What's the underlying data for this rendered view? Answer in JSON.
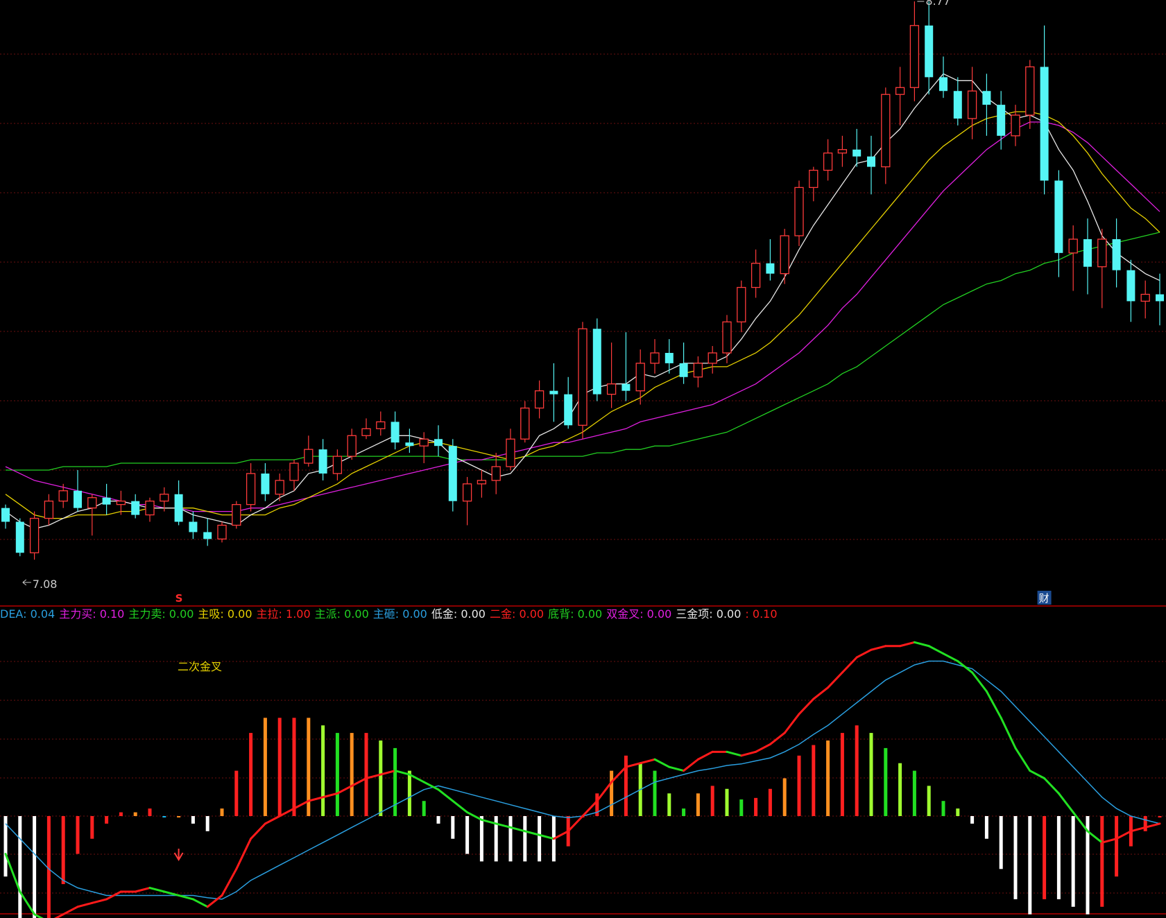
{
  "colors": {
    "background": "#000000",
    "grid": "#6e1010",
    "divider": "#b80000",
    "up": "#ff3b3b",
    "down": "#55f5f5",
    "ma5": "#e8e8e8",
    "ma10": "#e6d000",
    "ma20": "#e020e0",
    "ma60": "#22d022",
    "dif_rise": "#ff1a1a",
    "dif_fall": "#22e022",
    "dea": "#2a9fe0",
    "hist_neg": "#ffffff",
    "hist_neg_red": "#ff2020",
    "hist_pos_red": "#ff2020",
    "hist_pos_orange": "#ff9020",
    "hist_pos_green": "#22e022",
    "hist_pos_yellowgreen": "#a0ff30",
    "hist_blue": "#17b8f0"
  },
  "price_panel": {
    "high_label": "8.77",
    "low_label": "7.08",
    "s_marker": "S",
    "cai_marker": "财"
  },
  "legend": {
    "items": [
      {
        "name": "DEA",
        "value": "0.04",
        "color": "#2a9fe0"
      },
      {
        "name": "主力买",
        "value": "0.10",
        "color": "#e020e0"
      },
      {
        "name": "主力卖",
        "value": "0.00",
        "color": "#22d022"
      },
      {
        "name": "主吸",
        "value": "0.00",
        "color": "#e6d000"
      },
      {
        "name": "主拉",
        "value": "1.00",
        "color": "#ff2020"
      },
      {
        "name": "主派",
        "value": "0.00",
        "color": "#22d022"
      },
      {
        "name": "主砸",
        "value": "0.00",
        "color": "#2a9fe0"
      },
      {
        "name": "低金",
        "value": "0.00",
        "color": "#e8e8e8"
      },
      {
        "name": "二金",
        "value": "0.00",
        "color": "#ff2020"
      },
      {
        "name": "底背",
        "value": "0.00",
        "color": "#22d022"
      },
      {
        "name": "双金叉",
        "value": "0.00",
        "color": "#e020e0"
      },
      {
        "name": "三金项",
        "value": "0.00",
        "color": "#e8e8e8"
      },
      {
        "name": "",
        "value": "0.10",
        "color": "#ff2020"
      }
    ]
  },
  "macd_panel": {
    "annotation": "二次金叉"
  },
  "chart_data": [
    {
      "type": "candlestick",
      "low_label": "7.08",
      "high_label": "8.77",
      "ylim": [
        7.08,
        8.77
      ],
      "ohlc": [
        [
          7.3,
          7.31,
          7.24,
          7.26
        ],
        [
          7.26,
          7.27,
          7.16,
          7.17
        ],
        [
          7.17,
          7.29,
          7.15,
          7.27
        ],
        [
          7.27,
          7.34,
          7.25,
          7.32
        ],
        [
          7.32,
          7.37,
          7.3,
          7.35
        ],
        [
          7.35,
          7.41,
          7.29,
          7.3
        ],
        [
          7.3,
          7.34,
          7.22,
          7.33
        ],
        [
          7.33,
          7.37,
          7.28,
          7.31
        ],
        [
          7.31,
          7.35,
          7.28,
          7.32
        ],
        [
          7.32,
          7.34,
          7.27,
          7.28
        ],
        [
          7.28,
          7.33,
          7.26,
          7.32
        ],
        [
          7.32,
          7.36,
          7.29,
          7.34
        ],
        [
          7.34,
          7.38,
          7.25,
          7.26
        ],
        [
          7.26,
          7.29,
          7.21,
          7.23
        ],
        [
          7.23,
          7.27,
          7.19,
          7.21
        ],
        [
          7.21,
          7.26,
          7.2,
          7.25
        ],
        [
          7.25,
          7.32,
          7.24,
          7.31
        ],
        [
          7.31,
          7.43,
          7.29,
          7.4
        ],
        [
          7.4,
          7.43,
          7.32,
          7.34
        ],
        [
          7.34,
          7.4,
          7.32,
          7.38
        ],
        [
          7.38,
          7.44,
          7.35,
          7.43
        ],
        [
          7.43,
          7.51,
          7.42,
          7.47
        ],
        [
          7.47,
          7.5,
          7.38,
          7.4
        ],
        [
          7.4,
          7.47,
          7.38,
          7.45
        ],
        [
          7.45,
          7.53,
          7.44,
          7.51
        ],
        [
          7.51,
          7.56,
          7.5,
          7.53
        ],
        [
          7.53,
          7.58,
          7.51,
          7.55
        ],
        [
          7.55,
          7.58,
          7.47,
          7.49
        ],
        [
          7.49,
          7.53,
          7.46,
          7.48
        ],
        [
          7.48,
          7.52,
          7.43,
          7.5
        ],
        [
          7.5,
          7.54,
          7.45,
          7.48
        ],
        [
          7.48,
          7.5,
          7.29,
          7.32
        ],
        [
          7.32,
          7.39,
          7.25,
          7.37
        ],
        [
          7.37,
          7.41,
          7.33,
          7.38
        ],
        [
          7.38,
          7.46,
          7.34,
          7.42
        ],
        [
          7.42,
          7.53,
          7.41,
          7.5
        ],
        [
          7.5,
          7.61,
          7.49,
          7.59
        ],
        [
          7.59,
          7.67,
          7.56,
          7.64
        ],
        [
          7.64,
          7.72,
          7.55,
          7.63
        ],
        [
          7.63,
          7.68,
          7.53,
          7.54
        ],
        [
          7.54,
          7.84,
          7.5,
          7.82
        ],
        [
          7.82,
          7.85,
          7.61,
          7.63
        ],
        [
          7.63,
          7.78,
          7.59,
          7.66
        ],
        [
          7.66,
          7.81,
          7.61,
          7.64
        ],
        [
          7.64,
          7.76,
          7.6,
          7.72
        ],
        [
          7.72,
          7.79,
          7.69,
          7.75
        ],
        [
          7.75,
          7.79,
          7.69,
          7.72
        ],
        [
          7.72,
          7.78,
          7.66,
          7.68
        ],
        [
          7.68,
          7.74,
          7.65,
          7.72
        ],
        [
          7.72,
          7.77,
          7.69,
          7.75
        ],
        [
          7.75,
          7.86,
          7.72,
          7.84
        ],
        [
          7.84,
          7.96,
          7.81,
          7.94
        ],
        [
          7.94,
          8.05,
          7.91,
          8.01
        ],
        [
          8.01,
          8.08,
          7.96,
          7.98
        ],
        [
          7.98,
          8.11,
          7.95,
          8.09
        ],
        [
          8.09,
          8.25,
          8.06,
          8.23
        ],
        [
          8.23,
          8.29,
          8.19,
          8.28
        ],
        [
          8.28,
          8.37,
          8.25,
          8.33
        ],
        [
          8.33,
          8.38,
          8.29,
          8.34
        ],
        [
          8.34,
          8.4,
          8.29,
          8.32
        ],
        [
          8.32,
          8.38,
          8.21,
          8.29
        ],
        [
          8.29,
          8.52,
          8.24,
          8.5
        ],
        [
          8.5,
          8.58,
          8.41,
          8.52
        ],
        [
          8.52,
          8.77,
          8.48,
          8.7
        ],
        [
          8.7,
          8.77,
          8.5,
          8.55
        ],
        [
          8.55,
          8.61,
          8.49,
          8.51
        ],
        [
          8.51,
          8.55,
          8.41,
          8.43
        ],
        [
          8.43,
          8.58,
          8.37,
          8.51
        ],
        [
          8.51,
          8.56,
          8.38,
          8.47
        ],
        [
          8.47,
          8.51,
          8.34,
          8.38
        ],
        [
          8.38,
          8.47,
          8.35,
          8.44
        ],
        [
          8.44,
          8.6,
          8.4,
          8.58
        ],
        [
          8.58,
          8.7,
          8.21,
          8.25
        ],
        [
          8.25,
          8.28,
          7.97,
          8.04
        ],
        [
          8.04,
          8.12,
          7.93,
          8.08
        ],
        [
          8.08,
          8.14,
          7.92,
          8.0
        ],
        [
          8.0,
          8.11,
          7.88,
          8.08
        ],
        [
          8.08,
          8.14,
          7.94,
          7.99
        ],
        [
          7.99,
          8.02,
          7.84,
          7.9
        ],
        [
          7.9,
          7.96,
          7.85,
          7.92
        ],
        [
          7.92,
          7.98,
          7.83,
          7.9
        ]
      ],
      "ma5": [
        7.29,
        7.26,
        7.24,
        7.25,
        7.27,
        7.29,
        7.3,
        7.32,
        7.32,
        7.31,
        7.3,
        7.3,
        7.3,
        7.28,
        7.27,
        7.26,
        7.25,
        7.28,
        7.3,
        7.33,
        7.35,
        7.4,
        7.41,
        7.43,
        7.45,
        7.47,
        7.49,
        7.51,
        7.51,
        7.5,
        7.49,
        7.45,
        7.43,
        7.41,
        7.39,
        7.4,
        7.45,
        7.51,
        7.53,
        7.56,
        7.63,
        7.65,
        7.66,
        7.66,
        7.69,
        7.68,
        7.7,
        7.72,
        7.72,
        7.72,
        7.74,
        7.79,
        7.85,
        7.9,
        7.97,
        8.05,
        8.12,
        8.18,
        8.24,
        8.3,
        8.31,
        8.36,
        8.4,
        8.46,
        8.51,
        8.56,
        8.54,
        8.54,
        8.49,
        8.46,
        8.43,
        8.44,
        8.42,
        8.34,
        8.28,
        8.19,
        8.09,
        8.04,
        8.01,
        7.98,
        7.96
      ],
      "ma10": [
        7.34,
        7.31,
        7.28,
        7.27,
        7.27,
        7.28,
        7.28,
        7.28,
        7.29,
        7.29,
        7.3,
        7.3,
        7.3,
        7.3,
        7.29,
        7.28,
        7.28,
        7.28,
        7.28,
        7.3,
        7.31,
        7.33,
        7.35,
        7.37,
        7.4,
        7.42,
        7.44,
        7.46,
        7.48,
        7.49,
        7.49,
        7.48,
        7.47,
        7.46,
        7.45,
        7.44,
        7.45,
        7.47,
        7.48,
        7.5,
        7.52,
        7.55,
        7.58,
        7.6,
        7.62,
        7.65,
        7.67,
        7.69,
        7.7,
        7.71,
        7.71,
        7.73,
        7.75,
        7.78,
        7.82,
        7.86,
        7.91,
        7.96,
        8.01,
        8.06,
        8.11,
        8.16,
        8.21,
        8.26,
        8.31,
        8.35,
        8.38,
        8.41,
        8.43,
        8.44,
        8.45,
        8.45,
        8.44,
        8.42,
        8.38,
        8.33,
        8.27,
        8.22,
        8.17,
        8.14,
        8.1
      ],
      "ma20": [
        7.42,
        7.4,
        7.38,
        7.37,
        7.36,
        7.35,
        7.34,
        7.33,
        7.32,
        7.31,
        7.31,
        7.3,
        7.3,
        7.29,
        7.29,
        7.29,
        7.29,
        7.3,
        7.3,
        7.31,
        7.32,
        7.33,
        7.34,
        7.35,
        7.36,
        7.37,
        7.38,
        7.39,
        7.4,
        7.41,
        7.42,
        7.43,
        7.44,
        7.44,
        7.45,
        7.46,
        7.47,
        7.48,
        7.49,
        7.49,
        7.5,
        7.51,
        7.52,
        7.53,
        7.55,
        7.56,
        7.57,
        7.58,
        7.59,
        7.6,
        7.62,
        7.64,
        7.66,
        7.69,
        7.72,
        7.75,
        7.79,
        7.83,
        7.88,
        7.92,
        7.97,
        8.02,
        8.07,
        8.12,
        8.17,
        8.22,
        8.26,
        8.3,
        8.34,
        8.37,
        8.4,
        8.42,
        8.42,
        8.41,
        8.39,
        8.36,
        8.32,
        8.28,
        8.24,
        8.2,
        8.16
      ],
      "ma60": [
        7.41,
        7.41,
        7.41,
        7.41,
        7.42,
        7.42,
        7.42,
        7.42,
        7.43,
        7.43,
        7.43,
        7.43,
        7.43,
        7.43,
        7.43,
        7.43,
        7.43,
        7.44,
        7.44,
        7.44,
        7.44,
        7.45,
        7.45,
        7.45,
        7.45,
        7.45,
        7.45,
        7.45,
        7.45,
        7.45,
        7.45,
        7.44,
        7.44,
        7.44,
        7.44,
        7.44,
        7.45,
        7.45,
        7.45,
        7.45,
        7.45,
        7.46,
        7.46,
        7.47,
        7.47,
        7.48,
        7.48,
        7.49,
        7.5,
        7.51,
        7.52,
        7.54,
        7.56,
        7.58,
        7.6,
        7.62,
        7.64,
        7.66,
        7.69,
        7.71,
        7.74,
        7.77,
        7.8,
        7.83,
        7.86,
        7.89,
        7.91,
        7.93,
        7.95,
        7.96,
        7.98,
        7.99,
        8.01,
        8.02,
        8.04,
        8.05,
        8.06,
        8.07,
        8.08,
        8.09,
        8.1
      ]
    },
    {
      "type": "macd",
      "dif": [
        -0.05,
        -0.1,
        -0.13,
        -0.14,
        -0.13,
        -0.12,
        -0.115,
        -0.11,
        -0.1,
        -0.1,
        -0.095,
        -0.1,
        -0.105,
        -0.11,
        -0.12,
        -0.105,
        -0.07,
        -0.03,
        -0.01,
        0.0,
        0.01,
        0.02,
        0.025,
        0.03,
        0.04,
        0.05,
        0.055,
        0.06,
        0.055,
        0.045,
        0.035,
        0.02,
        0.005,
        -0.005,
        -0.01,
        -0.015,
        -0.02,
        -0.025,
        -0.03,
        -0.02,
        0.0,
        0.02,
        0.045,
        0.065,
        0.07,
        0.075,
        0.065,
        0.06,
        0.075,
        0.085,
        0.085,
        0.08,
        0.085,
        0.095,
        0.11,
        0.135,
        0.155,
        0.17,
        0.19,
        0.21,
        0.22,
        0.225,
        0.225,
        0.23,
        0.225,
        0.215,
        0.205,
        0.19,
        0.165,
        0.13,
        0.09,
        0.06,
        0.05,
        0.03,
        0.005,
        -0.02,
        -0.035,
        -0.03,
        -0.02,
        -0.015,
        -0.01
      ],
      "dea": [
        -0.01,
        -0.03,
        -0.05,
        -0.07,
        -0.085,
        -0.095,
        -0.1,
        -0.105,
        -0.105,
        -0.105,
        -0.105,
        -0.105,
        -0.105,
        -0.105,
        -0.108,
        -0.11,
        -0.1,
        -0.085,
        -0.075,
        -0.065,
        -0.055,
        -0.045,
        -0.035,
        -0.025,
        -0.015,
        -0.005,
        0.005,
        0.015,
        0.025,
        0.035,
        0.04,
        0.035,
        0.03,
        0.025,
        0.02,
        0.015,
        0.01,
        0.005,
        0.0,
        -0.002,
        0.0,
        0.005,
        0.015,
        0.025,
        0.035,
        0.045,
        0.05,
        0.055,
        0.06,
        0.063,
        0.067,
        0.069,
        0.073,
        0.077,
        0.085,
        0.095,
        0.108,
        0.12,
        0.135,
        0.15,
        0.165,
        0.18,
        0.19,
        0.2,
        0.205,
        0.205,
        0.2,
        0.195,
        0.18,
        0.165,
        0.145,
        0.125,
        0.105,
        0.085,
        0.065,
        0.045,
        0.025,
        0.01,
        0.0,
        -0.005,
        -0.01
      ],
      "hist": [
        -0.08,
        -0.14,
        -0.16,
        -0.14,
        -0.09,
        -0.05,
        -0.03,
        -0.01,
        0.005,
        0.005,
        0.01,
        0.0,
        0.0,
        -0.01,
        -0.02,
        0.01,
        0.06,
        0.11,
        0.13,
        0.13,
        0.13,
        0.13,
        0.12,
        0.11,
        0.11,
        0.11,
        0.1,
        0.09,
        0.06,
        0.02,
        -0.01,
        -0.03,
        -0.05,
        -0.06,
        -0.06,
        -0.06,
        -0.06,
        -0.06,
        -0.06,
        -0.04,
        0.0,
        0.03,
        0.06,
        0.08,
        0.07,
        0.06,
        0.03,
        0.01,
        0.03,
        0.04,
        0.036,
        0.022,
        0.024,
        0.036,
        0.05,
        0.08,
        0.094,
        0.1,
        0.11,
        0.12,
        0.11,
        0.09,
        0.07,
        0.06,
        0.04,
        0.02,
        0.01,
        -0.01,
        -0.03,
        -0.07,
        -0.11,
        -0.13,
        -0.11,
        -0.11,
        -0.12,
        -0.13,
        -0.12,
        -0.08,
        -0.04,
        -0.02,
        0.0
      ]
    }
  ]
}
